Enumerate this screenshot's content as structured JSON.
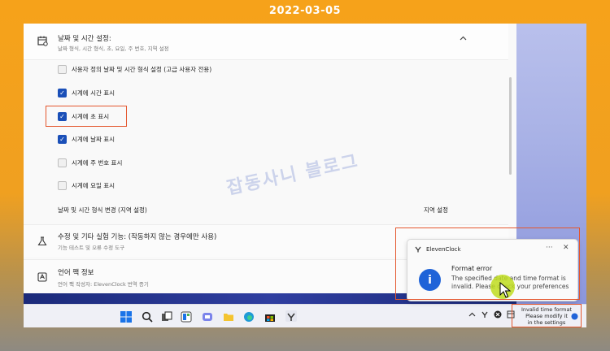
{
  "banner": {
    "date": "2022-03-05"
  },
  "section": {
    "title": "날짜 및 시간 설정:",
    "subtitle": "날짜 형식, 시간 형식, 초, 요일, 주 번호, 지역 설정"
  },
  "options": [
    {
      "label": "사용자 정의 날짜 및 시간 형식 설정 (고급 사용자 전용)",
      "checked": false
    },
    {
      "label": "시계에 시간 표시",
      "checked": true
    },
    {
      "label": "시계에 초 표시",
      "checked": true
    },
    {
      "label": "시계에 날짜 표시",
      "checked": true
    },
    {
      "label": "시계에 주 번호 표시",
      "checked": false
    },
    {
      "label": "시계에 요일 표시",
      "checked": false
    }
  ],
  "region_row": {
    "label": "날짜 및 시간 형식 변경 (지역 설정)",
    "button": "지역 설정"
  },
  "experimental": {
    "title": "수정 및 기타 실험 기능: (작동하지 않는 경우에만 사용)",
    "subtitle": "기능 테스트 및 오류 수정 도구"
  },
  "about": {
    "title": "언어 팩 정보",
    "subtitle": "언어 팩 작성자: ElevenClock 번역 증기"
  },
  "watermark": "잡동사니 블로그",
  "toast": {
    "app": "ElevenClock",
    "more": "···",
    "close": "✕",
    "title": "Format error",
    "body": "The specified date and time format is invalid. Please check your preferences"
  },
  "tray": {
    "line1": "Invalid time format",
    "line2": "Please modify it",
    "line3": "in the settings"
  }
}
